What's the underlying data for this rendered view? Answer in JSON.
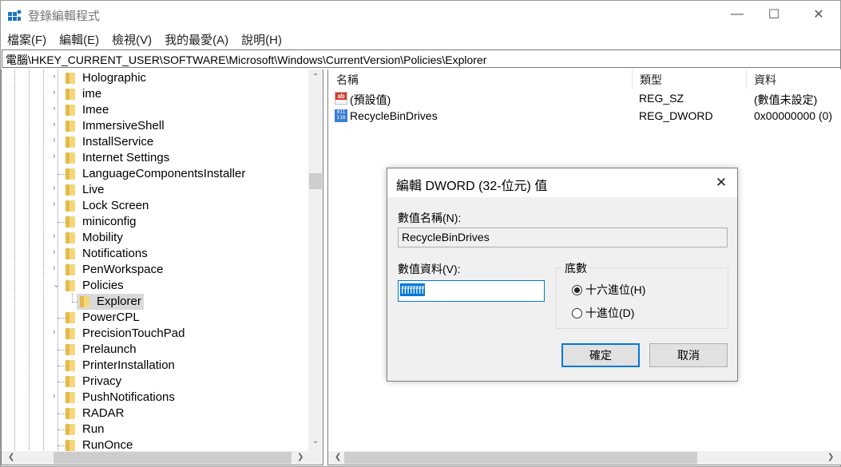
{
  "window": {
    "title": "登錄編輯程式",
    "controls": {
      "minimize": "—",
      "maximize": "☐",
      "close": "✕"
    }
  },
  "menu": [
    "檔案(F)",
    "編輯(E)",
    "檢視(V)",
    "我的最愛(A)",
    "說明(H)"
  ],
  "address": "電腦\\HKEY_CURRENT_USER\\SOFTWARE\\Microsoft\\Windows\\CurrentVersion\\Policies\\Explorer",
  "tree": {
    "items": [
      {
        "label": "Holographic",
        "expandable": true
      },
      {
        "label": "ime",
        "expandable": true
      },
      {
        "label": "Imee",
        "expandable": true
      },
      {
        "label": "ImmersiveShell",
        "expandable": true
      },
      {
        "label": "InstallService",
        "expandable": true
      },
      {
        "label": "Internet Settings",
        "expandable": true
      },
      {
        "label": "LanguageComponentsInstaller",
        "expandable": false
      },
      {
        "label": "Live",
        "expandable": true
      },
      {
        "label": "Lock Screen",
        "expandable": true
      },
      {
        "label": "miniconfig",
        "expandable": false
      },
      {
        "label": "Mobility",
        "expandable": true
      },
      {
        "label": "Notifications",
        "expandable": true
      },
      {
        "label": "PenWorkspace",
        "expandable": true
      },
      {
        "label": "Policies",
        "expandable": true,
        "expanded": true
      },
      {
        "label": "Explorer",
        "expandable": false,
        "child": true,
        "selected": true
      },
      {
        "label": "PowerCPL",
        "expandable": false
      },
      {
        "label": "PrecisionTouchPad",
        "expandable": true
      },
      {
        "label": "Prelaunch",
        "expandable": false
      },
      {
        "label": "PrinterInstallation",
        "expandable": false
      },
      {
        "label": "Privacy",
        "expandable": false
      },
      {
        "label": "PushNotifications",
        "expandable": true
      },
      {
        "label": "RADAR",
        "expandable": false
      },
      {
        "label": "Run",
        "expandable": false
      },
      {
        "label": "RunOnce",
        "expandable": false
      }
    ]
  },
  "list": {
    "columns": [
      "名稱",
      "類型",
      "資料"
    ],
    "rows": [
      {
        "icon": "string-value-icon",
        "name": "(預設值)",
        "type": "REG_SZ",
        "data": "(數值未設定)"
      },
      {
        "icon": "binary-value-icon",
        "name": "RecycleBinDrives",
        "type": "REG_DWORD",
        "data": "0x00000000 (0)"
      }
    ]
  },
  "dialog": {
    "title": "編輯 DWORD (32-位元) 值",
    "name_label": "數值名稱(N):",
    "name_value": "RecycleBinDrives",
    "data_label": "數值資料(V):",
    "data_value": "ffffffff",
    "base_label": "底數",
    "base_options": [
      {
        "label": "十六進位(H)",
        "checked": true
      },
      {
        "label": "十進位(D)",
        "checked": false
      }
    ],
    "ok_label": "確定",
    "cancel_label": "取消"
  }
}
